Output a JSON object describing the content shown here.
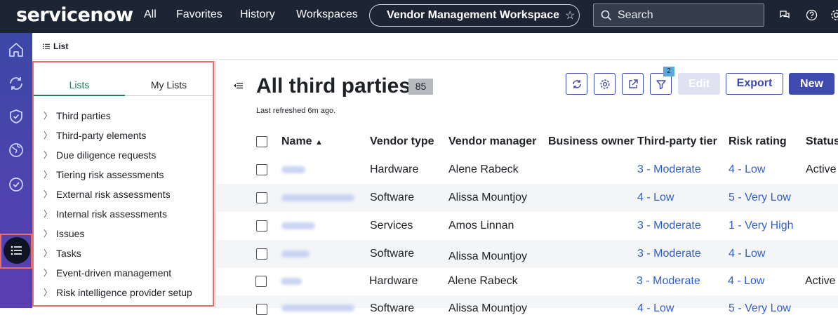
{
  "topbar": {
    "logo": "servicenow",
    "nav": [
      "All",
      "Favorites",
      "History",
      "Workspaces"
    ],
    "workspace": "Vendor Management Workspace",
    "search_placeholder": "Search"
  },
  "subbar": {
    "label": "List"
  },
  "panel": {
    "tabs": [
      "Lists",
      "My Lists"
    ],
    "items": [
      "Third parties",
      "Third-party elements",
      "Due diligence requests",
      "Tiering risk assessments",
      "External risk assessments",
      "Internal risk assessments",
      "Issues",
      "Tasks",
      "Event-driven management",
      "Risk intelligence provider setup"
    ]
  },
  "main": {
    "title": "All third parties",
    "count": "85",
    "refreshed": "Last refreshed 6m ago.",
    "filter_count": "2",
    "buttons": {
      "edit": "Edit",
      "export": "Export",
      "new": "New"
    }
  },
  "table": {
    "columns": [
      "Name",
      "Vendor type",
      "Vendor manager",
      "Business owner",
      "Third-party tier",
      "Risk rating",
      "Status"
    ],
    "rows": [
      {
        "vendor_type": "Hardware",
        "manager": "Alene Rabeck",
        "tier": "3 - Moderate",
        "risk": "4 - Low",
        "status": "Active"
      },
      {
        "vendor_type": "Software",
        "manager": "Alissa Mountjoy",
        "tier": "4 - Low",
        "risk": "5 - Very Low",
        "status": ""
      },
      {
        "vendor_type": "Services",
        "manager": "Amos Linnan",
        "tier": "3 - Moderate",
        "risk": "1 - Very High",
        "status": ""
      },
      {
        "vendor_type": "Software",
        "manager": "Alissa Mountjoy",
        "tier": "3 - Moderate",
        "risk": "4 - Low",
        "status": ""
      },
      {
        "vendor_type": "Hardware",
        "manager": "Alene Rabeck",
        "tier": "3 - Moderate",
        "risk": "4 - Low",
        "status": "Active"
      },
      {
        "vendor_type": "Software",
        "manager": "Alissa Mountjoy",
        "tier": "4 - Low",
        "risk": "5 - Very Low",
        "status": ""
      }
    ]
  },
  "colors": {
    "topbar": "#1d2433",
    "accent": "#3e4aad",
    "link": "#2f5fd0",
    "highlight": "#e36f6f",
    "tab_active": "#1d7d5c"
  },
  "icons": [
    "home-icon",
    "refresh-icon",
    "shield-icon",
    "globe-icon",
    "check-circle-icon",
    "list-icon",
    "search-icon",
    "chat-icon",
    "help-icon",
    "gear-icon",
    "share-icon",
    "filter-icon",
    "star-icon"
  ]
}
